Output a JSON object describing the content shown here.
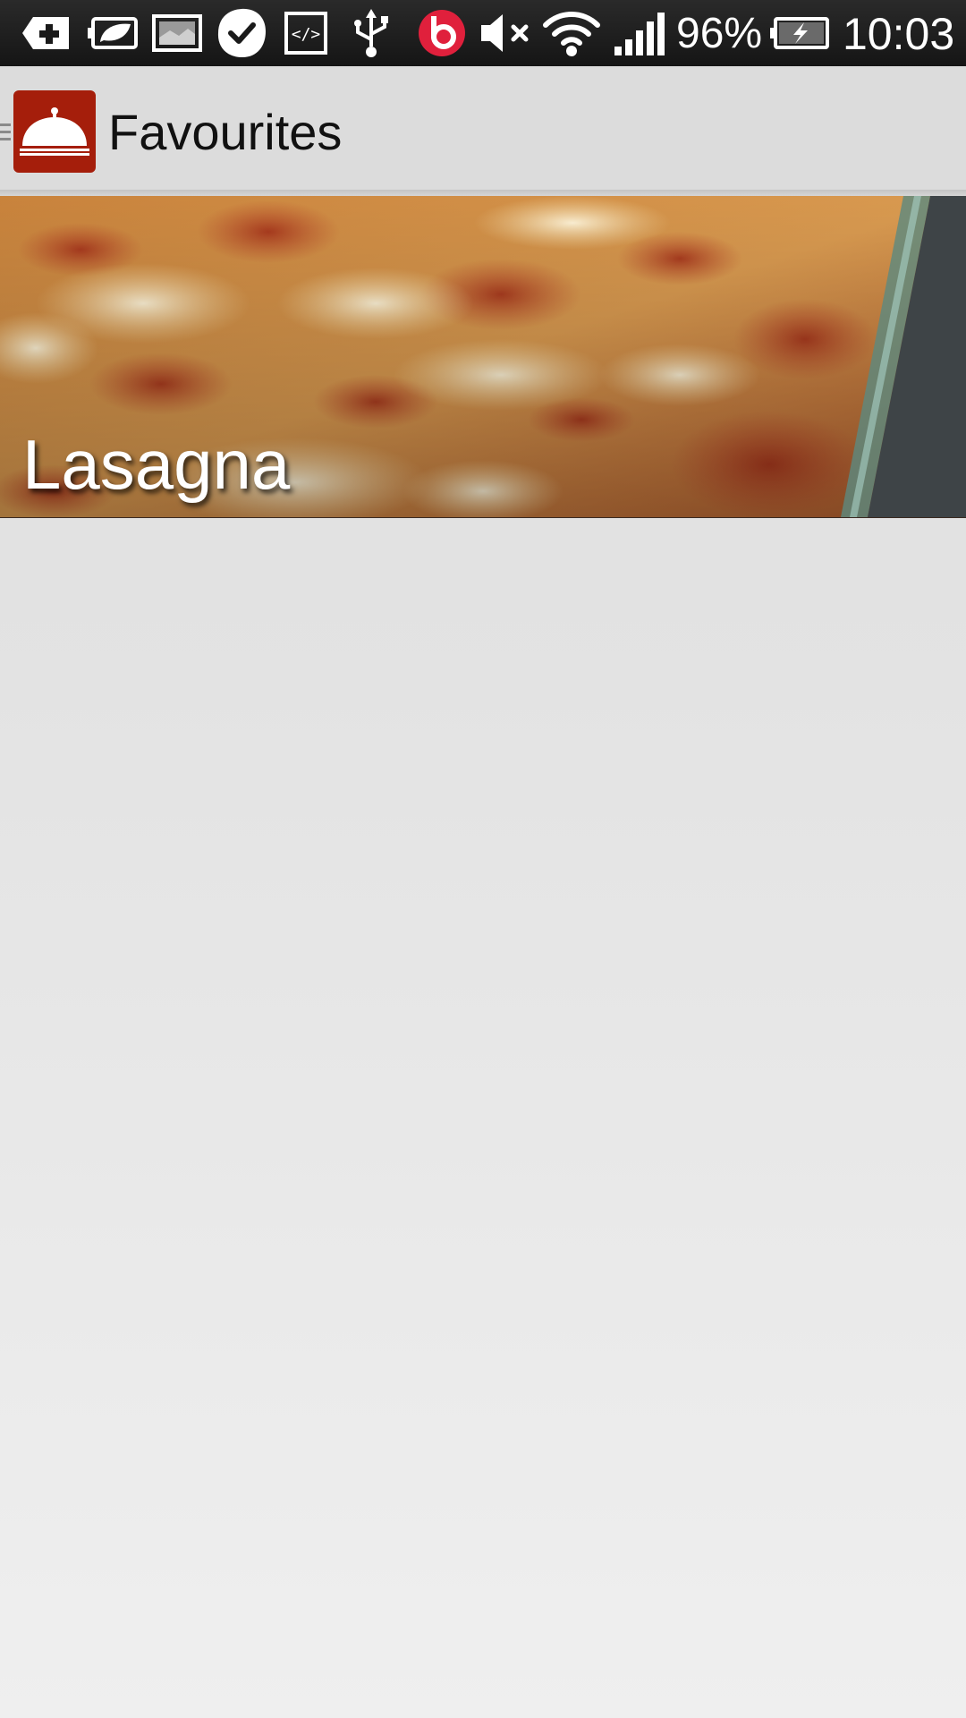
{
  "status_bar": {
    "battery_percent": "96%",
    "clock": "10:03",
    "icons": [
      "add-box-icon",
      "eco-battery-icon",
      "gallery-icon",
      "task-check-icon",
      "code-icon",
      "usb-icon",
      "beats-audio-icon",
      "mute-icon",
      "wifi-icon",
      "signal-icon",
      "battery-charging-icon"
    ],
    "beats_color": "#e0203c"
  },
  "action_bar": {
    "title": "Favourites",
    "logo_color": "#a51e0b",
    "logo_icon": "serving-dome-icon"
  },
  "favourites": [
    {
      "name": "Lasagna",
      "image": "lasagna-photo"
    }
  ]
}
